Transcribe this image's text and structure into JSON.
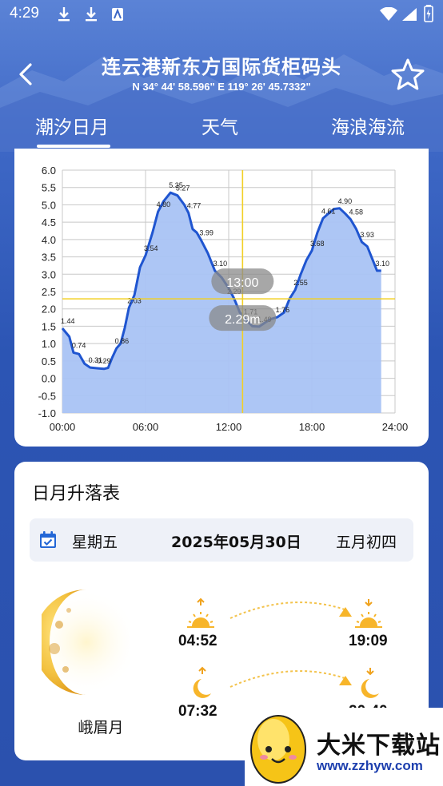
{
  "status_bar": {
    "time": "4:29"
  },
  "header": {
    "title": "连云港新东方国际货柜码头",
    "coords": "N 34° 44' 58.596\"  E 119° 26' 45.7332\""
  },
  "tabs": [
    {
      "label": "潮汐日月",
      "active": true
    },
    {
      "label": "天气",
      "active": false
    },
    {
      "label": "海浪海流",
      "active": false
    }
  ],
  "chart_data": {
    "type": "area",
    "title": "",
    "xlabel": "",
    "ylabel": "",
    "x_ticks": [
      "00:00",
      "06:00",
      "12:00",
      "18:00",
      "24:00"
    ],
    "y_ticks": [
      "6.0",
      "5.5",
      "5.0",
      "4.5",
      "4.0",
      "3.5",
      "3.0",
      "2.5",
      "2.0",
      "1.5",
      "1.0",
      "0.5",
      "0.0",
      "-0.5",
      "-1.0"
    ],
    "xlim": [
      0,
      24
    ],
    "ylim": [
      -1.0,
      6.0
    ],
    "grid": true,
    "fill_color": "#a9c3f4",
    "line_color": "#1f55d0",
    "crosshair_color": "#f2d024",
    "series": [
      {
        "x": [
          0,
          0.5,
          0.8,
          1.2,
          1.6,
          2.0,
          2.5,
          3.0,
          3.3,
          3.6,
          3.9,
          4.2,
          4.5,
          4.8,
          5.2,
          5.6,
          6.0,
          6.5,
          6.9,
          7.3,
          7.8,
          8.3,
          8.8,
          9.1,
          9.4,
          9.7,
          10.0,
          10.5,
          11.0,
          11.5,
          12.0,
          12.4,
          12.8,
          13.2,
          13.7,
          14.2,
          14.6,
          15.0,
          15.5,
          16.0,
          16.4,
          16.8,
          17.2,
          17.6,
          18.0,
          18.4,
          18.8,
          19.2,
          19.6,
          20.0,
          20.4,
          20.8,
          21.2,
          21.6,
          22.0,
          22.4,
          22.7,
          23.0
        ],
        "y": [
          1.44,
          1.2,
          0.74,
          0.7,
          0.42,
          0.31,
          0.29,
          0.27,
          0.3,
          0.6,
          0.86,
          1.0,
          1.45,
          2.03,
          2.4,
          3.2,
          3.54,
          4.2,
          4.8,
          5.1,
          5.35,
          5.27,
          5.0,
          4.77,
          4.3,
          4.2,
          3.99,
          3.6,
          3.1,
          2.9,
          2.6,
          2.29,
          1.9,
          1.71,
          1.5,
          1.49,
          1.6,
          1.7,
          1.76,
          1.9,
          2.3,
          2.55,
          3.0,
          3.4,
          3.68,
          4.2,
          4.61,
          4.75,
          4.88,
          4.9,
          4.75,
          4.58,
          4.3,
          3.93,
          3.8,
          3.4,
          3.1,
          3.1
        ]
      }
    ],
    "point_labels": [
      {
        "x": 0.0,
        "y": 1.44,
        "text": "1.44"
      },
      {
        "x": 0.8,
        "y": 0.74,
        "text": "0.74"
      },
      {
        "x": 2.0,
        "y": 0.31,
        "text": "0.31"
      },
      {
        "x": 2.6,
        "y": 0.29,
        "text": "0.29"
      },
      {
        "x": 3.9,
        "y": 0.86,
        "text": "0.86"
      },
      {
        "x": 4.8,
        "y": 2.03,
        "text": "2.03"
      },
      {
        "x": 6.0,
        "y": 3.54,
        "text": "3.54"
      },
      {
        "x": 6.9,
        "y": 4.8,
        "text": "4.80"
      },
      {
        "x": 7.8,
        "y": 5.35,
        "text": "5.35"
      },
      {
        "x": 8.3,
        "y": 5.27,
        "text": "5.27"
      },
      {
        "x": 9.1,
        "y": 4.77,
        "text": "4.77"
      },
      {
        "x": 10.0,
        "y": 3.99,
        "text": "3.99"
      },
      {
        "x": 11.0,
        "y": 3.1,
        "text": "3.10"
      },
      {
        "x": 12.0,
        "y": 2.29,
        "text": "2.29"
      },
      {
        "x": 13.2,
        "y": 1.71,
        "text": "1.71"
      },
      {
        "x": 14.2,
        "y": 1.49,
        "text": "1.49"
      },
      {
        "x": 15.5,
        "y": 1.76,
        "text": "1.76"
      },
      {
        "x": 16.8,
        "y": 2.55,
        "text": "2.55"
      },
      {
        "x": 18.0,
        "y": 3.68,
        "text": "3.68"
      },
      {
        "x": 18.8,
        "y": 4.61,
        "text": "4.61"
      },
      {
        "x": 20.0,
        "y": 4.9,
        "text": "4.90"
      },
      {
        "x": 20.8,
        "y": 4.58,
        "text": "4.58"
      },
      {
        "x": 21.6,
        "y": 3.93,
        "text": "3.93"
      },
      {
        "x": 22.7,
        "y": 3.1,
        "text": "3.10"
      }
    ],
    "crosshair": {
      "x": 13.0,
      "y": 2.29,
      "time_label": "13:00",
      "value_label": "2.29m"
    }
  },
  "sun_moon": {
    "title": "日月升落表",
    "weekday": "星期五",
    "date": "2025年05月30日",
    "lunar_date": "五月初四",
    "moon_phase": "峨眉月",
    "sunrise": "04:52",
    "sunset": "19:09",
    "moonrise": "07:32",
    "moonset": "20:40"
  },
  "watermark": {
    "name": "大米下载站",
    "url": "www.zzhyw.com"
  }
}
